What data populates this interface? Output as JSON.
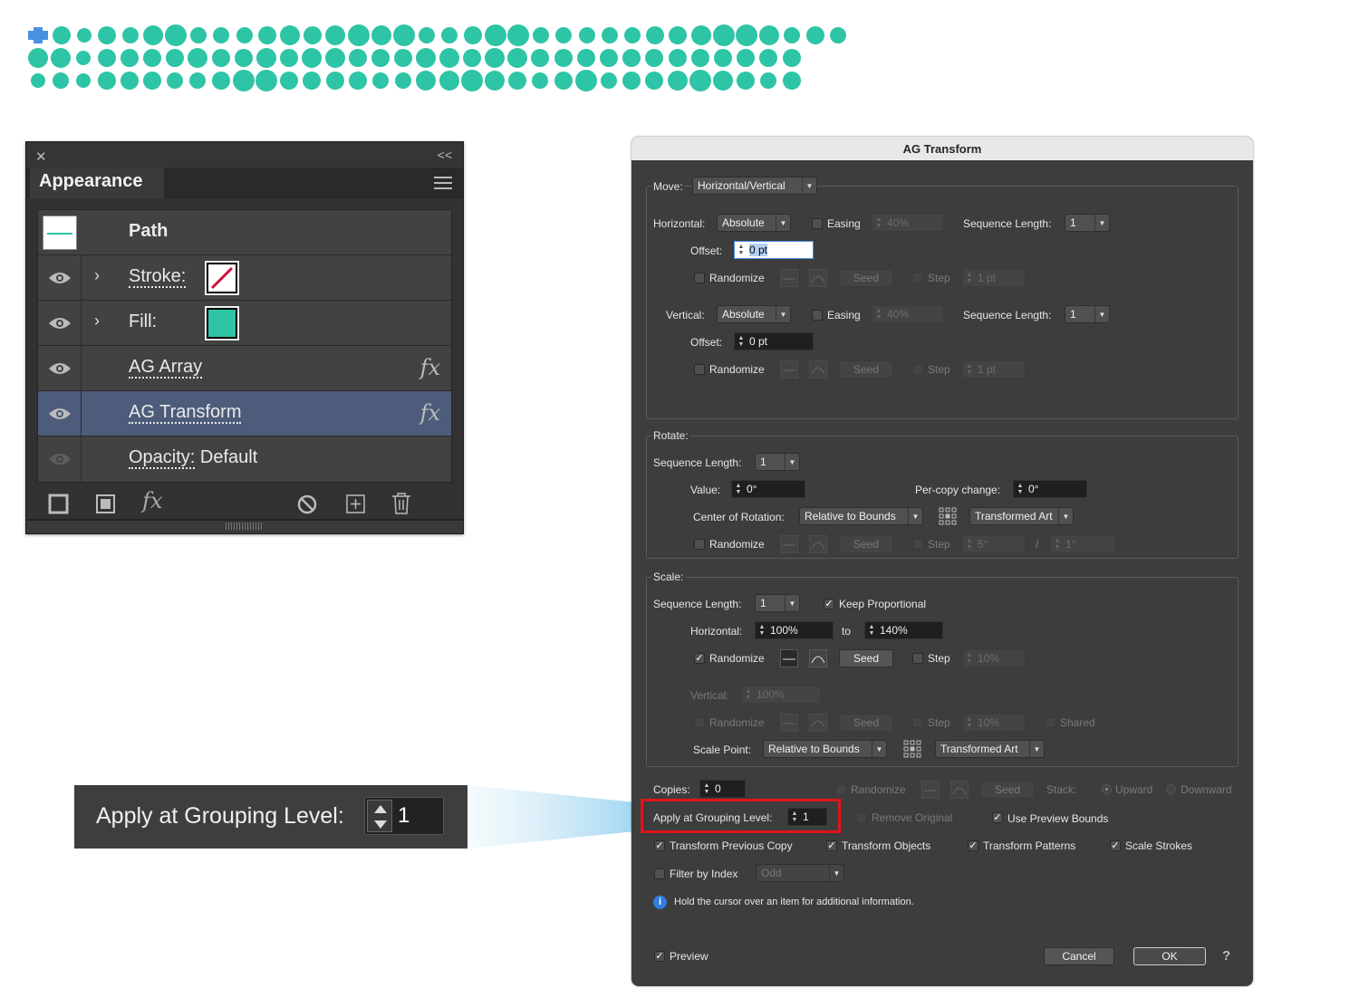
{
  "colors": {
    "dot": "#2ec4a6",
    "selection_handle": "#4a90e2"
  },
  "appearance": {
    "title": "Appearance",
    "rows": [
      {
        "label": "Path"
      },
      {
        "label": "Stroke:"
      },
      {
        "label": "Fill:"
      },
      {
        "label": "AG Array",
        "fx": "fx"
      },
      {
        "label": "AG Transform",
        "fx": "fx"
      },
      {
        "label": "Opacity:",
        "value": "Default"
      }
    ],
    "footer_icons": [
      "new-stroke-icon",
      "new-fill-icon",
      "fx-menu-icon",
      "clear-appearance-icon",
      "duplicate-item-icon",
      "trash-icon"
    ]
  },
  "callout": {
    "label": "Apply at Grouping Level:",
    "value": "1"
  },
  "dialog": {
    "title": "AG Transform",
    "move": {
      "label": "Move:",
      "mode": "Horizontal/Vertical",
      "horizontal": {
        "label": "Horizontal:",
        "type": "Absolute",
        "easing": "Easing",
        "easing_value": "40%",
        "seq_label": "Sequence Length:",
        "seq": "1",
        "offset_label": "Offset:",
        "offset": "0 pt",
        "randomize": "Randomize",
        "seed": "Seed",
        "step": "Step",
        "step_value": "1 pt"
      },
      "vertical": {
        "label": "Vertical:",
        "type": "Absolute",
        "easing": "Easing",
        "easing_value": "40%",
        "seq_label": "Sequence Length:",
        "seq": "1",
        "offset_label": "Offset:",
        "offset": "0 pt",
        "randomize": "Randomize",
        "seed": "Seed",
        "step": "Step",
        "step_value": "1 pt"
      }
    },
    "rotate": {
      "label": "Rotate:",
      "seq_label": "Sequence Length:",
      "seq": "1",
      "value_label": "Value:",
      "value": "0°",
      "per_copy_label": "Per-copy change:",
      "per_copy": "0°",
      "center_label": "Center of Rotation:",
      "center": "Relative to Bounds",
      "center_art": "Transformed Art",
      "randomize": "Randomize",
      "seed": "Seed",
      "step": "Step",
      "step_value": "5°",
      "slash": "/",
      "step_value2": "1°"
    },
    "scale": {
      "label": "Scale:",
      "seq_label": "Sequence Length:",
      "seq": "1",
      "keep": "Keep Proportional",
      "h_label": "Horizontal:",
      "h_from": "100%",
      "to": "to",
      "h_to": "140%",
      "randomize": "Randomize",
      "seed": "Seed",
      "step": "Step",
      "step_value": "10%",
      "v_label": "Vertical:",
      "v_value": "100%",
      "v_randomize": "Randomize",
      "v_seed": "Seed",
      "v_step": "Step",
      "v_step_value": "10%",
      "shared": "Shared",
      "point_label": "Scale Point:",
      "point": "Relative to Bounds",
      "point_art": "Transformed Art"
    },
    "copies": {
      "label": "Copies:",
      "value": "0",
      "randomize": "Randomize",
      "seed": "Seed",
      "stack_label": "Stack:",
      "upward": "Upward",
      "downward": "Downward"
    },
    "grouping": {
      "label": "Apply at Grouping Level:",
      "value": "1"
    },
    "remove_original": "Remove Original",
    "use_preview_bounds": "Use Preview Bounds",
    "transform_previous_copy": "Transform Previous Copy",
    "transform_objects": "Transform Objects",
    "transform_patterns": "Transform Patterns",
    "scale_strokes": "Scale Strokes",
    "filter_by_index": "Filter by Index",
    "filter_value": "Odd",
    "info": "Hold the cursor over an item for additional information.",
    "preview": "Preview",
    "cancel": "Cancel",
    "ok": "OK",
    "help": "?"
  },
  "dot_rows": [
    [
      20,
      16,
      20,
      18,
      22,
      24,
      18,
      18,
      18,
      20,
      22,
      20,
      22,
      24,
      22,
      24,
      18,
      18,
      20,
      24,
      24,
      18,
      18,
      18,
      18,
      18,
      20,
      20,
      22,
      24,
      24,
      22,
      18,
      20,
      18
    ],
    [
      22,
      22,
      16,
      20,
      20,
      20,
      20,
      22,
      20,
      20,
      22,
      20,
      22,
      22,
      20,
      20,
      20,
      22,
      22,
      20,
      22,
      22,
      20,
      20,
      20,
      20,
      20,
      20,
      20,
      20,
      20,
      20,
      20,
      20
    ],
    [
      16,
      18,
      16,
      20,
      20,
      20,
      18,
      18,
      20,
      24,
      24,
      20,
      20,
      20,
      20,
      18,
      18,
      22,
      22,
      24,
      22,
      20,
      18,
      20,
      24,
      18,
      20,
      20,
      22,
      24,
      22,
      20,
      18,
      20
    ]
  ]
}
